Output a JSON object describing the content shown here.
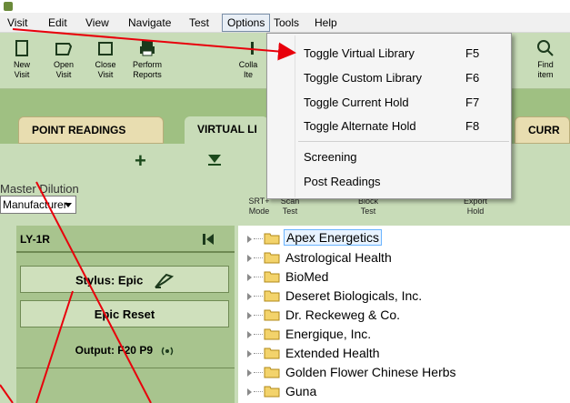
{
  "menubar": {
    "items": [
      "Visit",
      "Edit",
      "View",
      "Navigate",
      "Test",
      "Options",
      "Tools",
      "Help"
    ]
  },
  "toolbar": {
    "buttons": [
      {
        "label": "New\nVisit",
        "icon": "new-visit-icon"
      },
      {
        "label": "Open\nVisit",
        "icon": "open-visit-icon"
      },
      {
        "label": "Close\nVisit",
        "icon": "close-visit-icon"
      },
      {
        "label": "Perform\nReports",
        "icon": "printer-icon"
      },
      {
        "label": "Colla\nIte",
        "icon": "collapse-icon"
      },
      {
        "label": "Find\nitem",
        "icon": "magnifier-icon"
      }
    ]
  },
  "tabs": [
    "POINT READINGS",
    "VIRTUAL LI",
    "CURR"
  ],
  "controls": {
    "master_dilution_label": "Master Dilution",
    "master_dilution_value": "Manufacturer",
    "srt_label": "SRT+\nMode",
    "scan_label": "Scan\nTest",
    "block_label": "Block\nTest",
    "export_label": "Export\nHold"
  },
  "left_panel": {
    "header": "LY-1R",
    "stylus_button": "Stylus: Epic",
    "reset_button": "Epic Reset",
    "output": "Output: F20 P9"
  },
  "tree": {
    "items": [
      "Apex Energetics",
      "Astrological Health",
      "BioMed",
      "Deseret Biologicals, Inc.",
      "Dr. Reckeweg & Co.",
      "Energique, Inc.",
      "Extended Health",
      "Golden Flower Chinese Herbs",
      "Guna"
    ]
  },
  "options_menu": {
    "items": [
      {
        "label": "Toggle Virtual Library",
        "key": "F5"
      },
      {
        "label": "Toggle Custom Library",
        "key": "F6"
      },
      {
        "label": "Toggle Current Hold",
        "key": "F7"
      },
      {
        "label": "Toggle Alternate Hold",
        "key": "F8"
      },
      {
        "label": "Screening",
        "key": ""
      },
      {
        "label": "Post Readings",
        "key": ""
      }
    ]
  },
  "colors": {
    "panel_green": "#a8c48e",
    "tab_tan": "#e8ddb0",
    "arrow_red": "#e8000b"
  }
}
